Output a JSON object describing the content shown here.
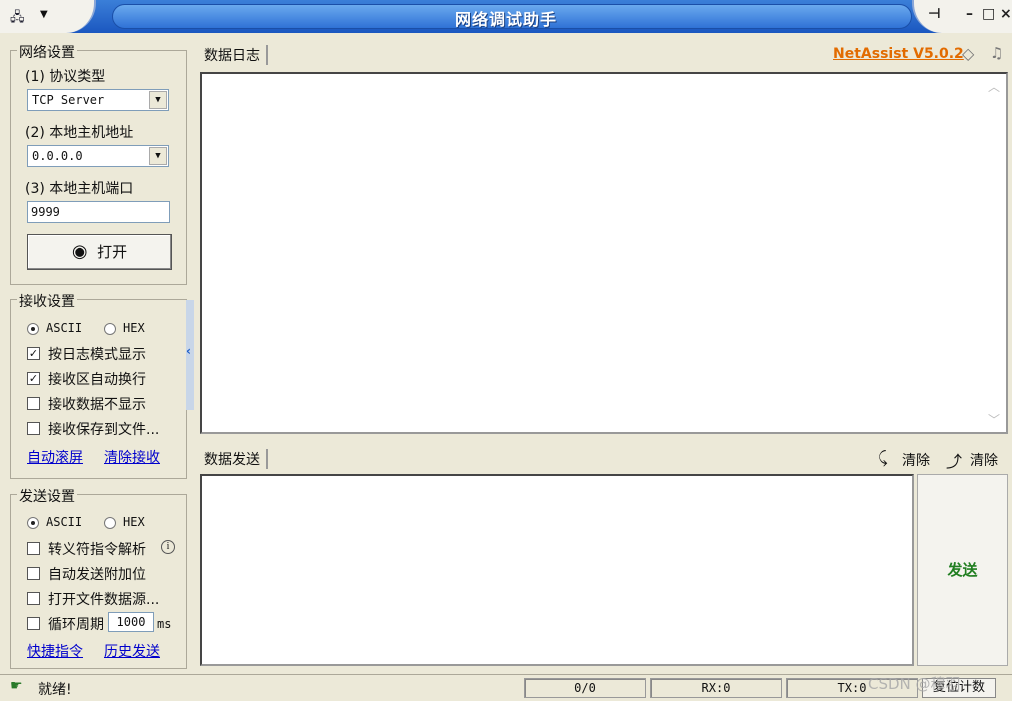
{
  "window": {
    "title": "网络调试助手",
    "version": "NetAssist V5.0.2"
  },
  "network": {
    "group_title": "网络设置",
    "protocol_label": "(1) 协议类型",
    "protocol_value": "TCP Server",
    "host_label": "(2) 本地主机地址",
    "host_value": "0.0.0.0",
    "port_label": "(3) 本地主机端口",
    "port_value": "9999",
    "open_label": "打开"
  },
  "receive": {
    "group_title": "接收设置",
    "ascii": "ASCII",
    "hex": "HEX",
    "opt_log_mode": "按日志模式显示",
    "opt_auto_wrap": "接收区自动换行",
    "opt_hide_data": "接收数据不显示",
    "opt_save_file": "接收保存到文件...",
    "link_autoscroll": "自动滚屏",
    "link_clear": "清除接收"
  },
  "send": {
    "group_title": "发送设置",
    "ascii": "ASCII",
    "hex": "HEX",
    "opt_escape": "转义符指令解析",
    "opt_append": "自动发送附加位",
    "opt_file_source": "打开文件数据源...",
    "opt_cycle": "循环周期",
    "cycle_value": "1000",
    "cycle_unit": "ms",
    "link_shortcut": "快捷指令",
    "link_history": "历史发送"
  },
  "main": {
    "log_tab": "数据日志",
    "send_tab": "数据发送",
    "clear1": "清除",
    "clear2": "清除",
    "send_button": "发送"
  },
  "status": {
    "text": "就绪!",
    "count": "0/0",
    "rx": "RX:0",
    "tx": "TX:0",
    "reset": "复位计数",
    "watermark": "CSDN @穆羽"
  },
  "colors": {
    "accent": "#1b57c0",
    "version": "#e26b00",
    "send": "#207e20"
  }
}
